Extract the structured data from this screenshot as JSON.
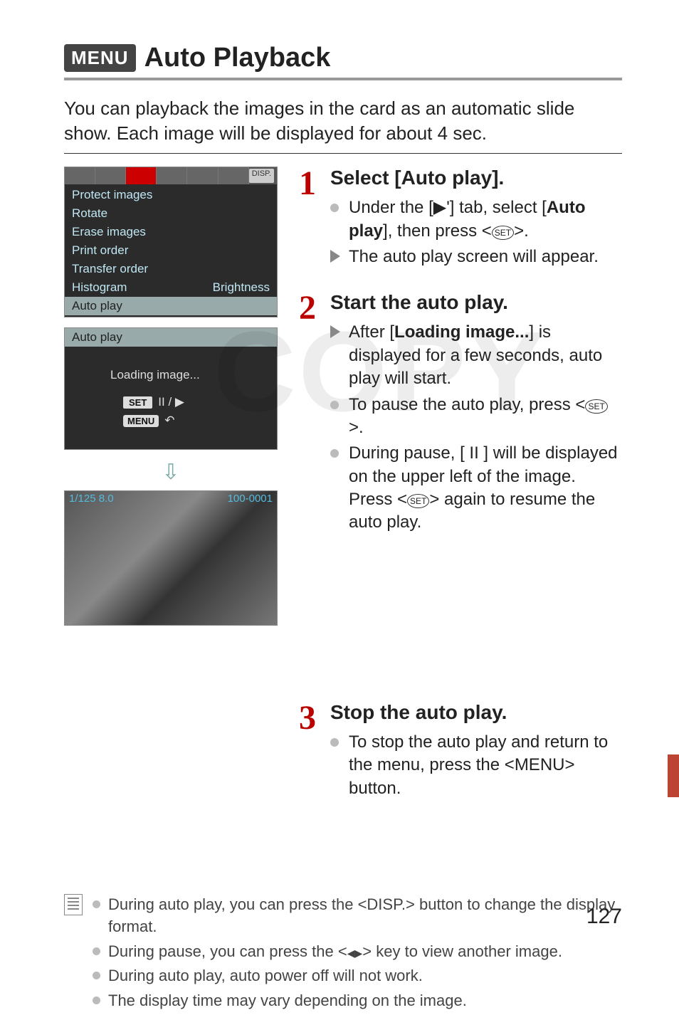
{
  "title_badge": "MENU",
  "title": "Auto Playback",
  "intro": "You can playback the images in the card as an automatic slide show. Each image will be displayed for about 4 sec.",
  "menu_screenshot": {
    "disp_tag": "DISP.",
    "items": [
      "Protect images",
      "Rotate",
      "Erase images",
      "Print order",
      "Transfer order"
    ],
    "histogram_label": "Histogram",
    "histogram_value": "Brightness",
    "selected": "Auto play"
  },
  "autoplay_screenshot": {
    "title": "Auto play",
    "loading": "Loading image...",
    "set": "SET",
    "pause_glyph": "II / ▶",
    "menu": "MENU",
    "back_glyph": "↶"
  },
  "photo_info": {
    "left": "1/125    8.0",
    "right": "100-0001"
  },
  "steps": [
    {
      "num": "1",
      "heading": "Select [Auto play].",
      "lines": [
        {
          "type": "dot",
          "html": "Under the [▶'] tab, select [<b>Auto play</b>], then press <SET>."
        },
        {
          "type": "tri",
          "html": "The auto play screen will appear."
        }
      ]
    },
    {
      "num": "2",
      "heading": "Start the auto play.",
      "lines": [
        {
          "type": "tri",
          "html": "After [<b>Loading image...</b>] is displayed for a few seconds, auto play will start."
        },
        {
          "type": "dot",
          "html": "To pause the auto play, press <SET>."
        },
        {
          "type": "dot",
          "html": "During pause, [ II ] will be displayed on the upper left of the image. Press <SET> again to resume the auto play."
        }
      ]
    },
    {
      "num": "3",
      "heading": "Stop the auto play.",
      "lines": [
        {
          "type": "dot",
          "html": "To stop the auto play and return to the menu, press the <MENU_BTN> button."
        }
      ]
    }
  ],
  "notes": [
    "During auto play, you can press the <DISP_BTN> button to change the display format.",
    "During pause, you can press the <LR_KEY> key to view another image.",
    "During auto play, auto power off will not work.",
    "The display time may vary depending on the image."
  ],
  "page_number": "127",
  "watermark": "COPY",
  "menu_button_label": "MENU",
  "disp_button_label": "DISP."
}
